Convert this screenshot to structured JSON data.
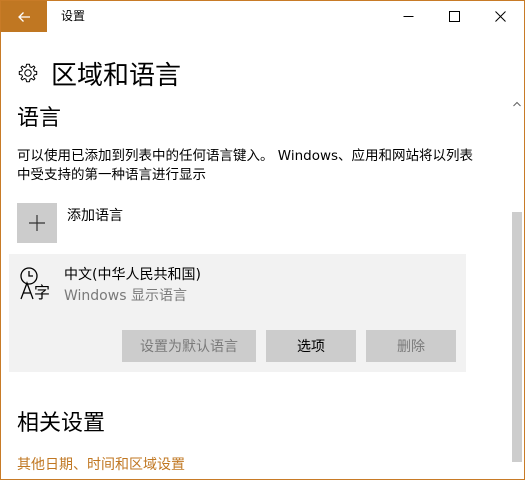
{
  "window": {
    "title": "设置",
    "accent_color": "#c07722"
  },
  "header": {
    "icon": "gear-icon",
    "title": "区域和语言"
  },
  "language_section": {
    "title": "语言",
    "description": "可以使用已添加到列表中的任何语言键入。 Windows、应用和网站将以列表中受支持的第一种语言进行显示",
    "add_label": "添加语言",
    "languages": [
      {
        "name": "中文(中华人民共和国)",
        "subtitle": "Windows 显示语言",
        "icon": "language-icon",
        "buttons": {
          "set_default": "设置为默认语言",
          "options": "选项",
          "remove": "删除"
        }
      }
    ]
  },
  "related_section": {
    "title": "相关设置",
    "link": "其他日期、时间和区域设置"
  }
}
